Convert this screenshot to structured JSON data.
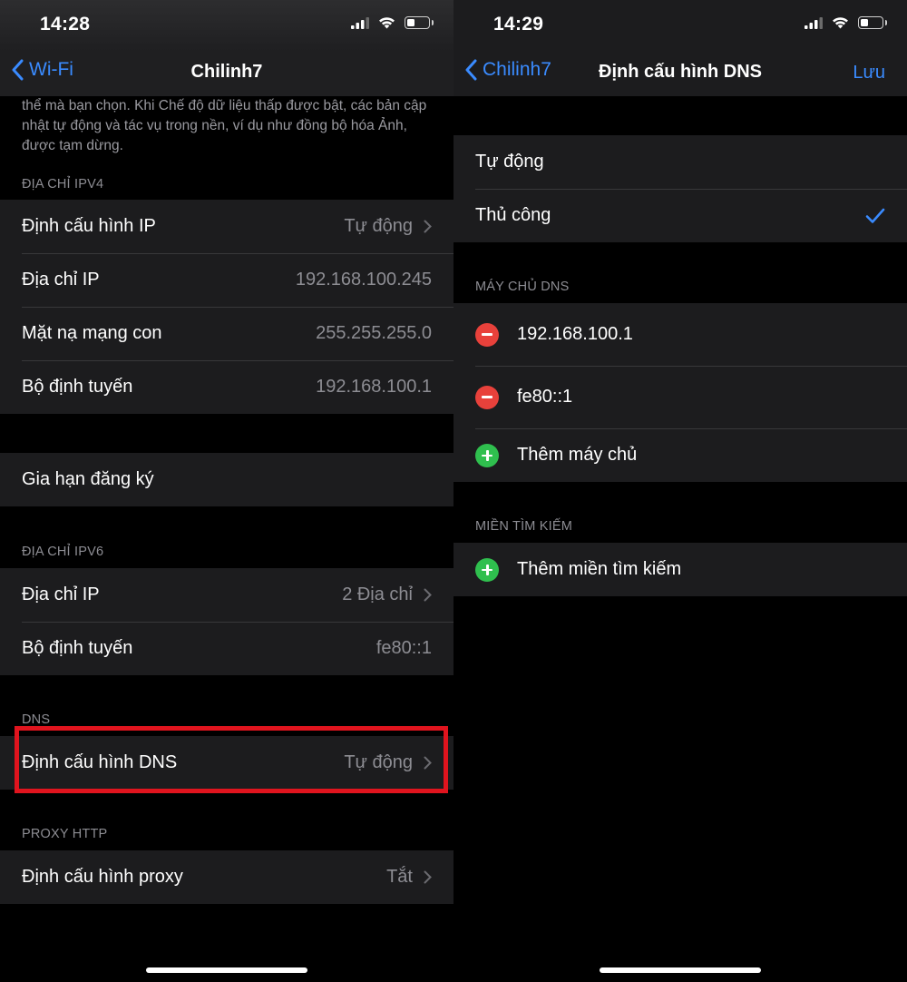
{
  "left": {
    "status": {
      "time": "14:28"
    },
    "nav": {
      "back_label": "Wi-Fi",
      "title": "Chilinh7"
    },
    "low_data_footer": "thể mà bạn chọn. Khi Chế độ dữ liệu thấp được bật, các bản cập nhật tự động và tác vụ trong nền, ví dụ như đồng bộ hóa Ảnh, được tạm dừng.",
    "ipv4": {
      "header": "ĐỊA CHỈ IPV4",
      "rows": [
        {
          "label": "Định cấu hình IP",
          "value": "Tự động"
        },
        {
          "label": "Địa chỉ IP",
          "value": "192.168.100.245"
        },
        {
          "label": "Mặt nạ mạng con",
          "value": "255.255.255.0"
        },
        {
          "label": "Bộ định tuyến",
          "value": "192.168.100.1"
        }
      ]
    },
    "renew_lease": "Gia hạn đăng ký",
    "ipv6": {
      "header": "ĐỊA CHỈ IPV6",
      "rows": [
        {
          "label": "Địa chỉ IP",
          "value": "2 Địa chỉ"
        },
        {
          "label": "Bộ định tuyến",
          "value": "fe80::1"
        }
      ]
    },
    "dns": {
      "header": "DNS",
      "row": {
        "label": "Định cấu hình DNS",
        "value": "Tự động"
      }
    },
    "proxy": {
      "header": "PROXY HTTP",
      "row": {
        "label": "Định cấu hình proxy",
        "value": "Tắt"
      }
    }
  },
  "right": {
    "status": {
      "time": "14:29"
    },
    "nav": {
      "back_label": "Chilinh7",
      "title": "Định cấu hình DNS",
      "save_label": "Lưu"
    },
    "mode": {
      "options": [
        "Tự động",
        "Thủ công"
      ],
      "selected": "Thủ công"
    },
    "dns_servers": {
      "header": "MÁY CHỦ DNS",
      "servers": [
        "192.168.100.1",
        "fe80::1"
      ],
      "add_label": "Thêm máy chủ"
    },
    "search_domains": {
      "header": "MIỀN TÌM KIẾM",
      "add_label": "Thêm miền tìm kiếm"
    }
  },
  "colors": {
    "accent": "#3a8bff",
    "highlight_border": "#e0141e",
    "delete": "#e8413b",
    "add": "#2fbf4e"
  }
}
